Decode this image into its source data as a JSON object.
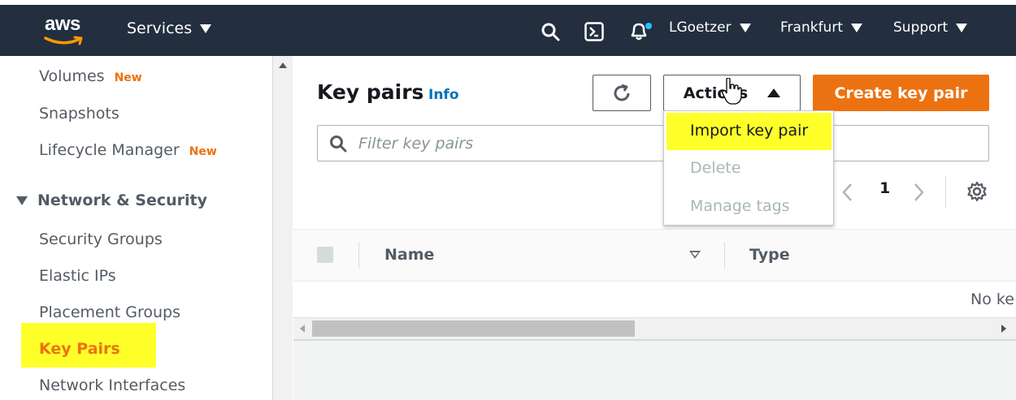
{
  "topbar": {
    "logo_text": "aws",
    "services_label": "Services",
    "user_label": "LGoetzer",
    "region_label": "Frankfurt",
    "support_label": "Support"
  },
  "sidebar": {
    "items": [
      {
        "label": "Volumes",
        "badge": "New"
      },
      {
        "label": "Snapshots"
      },
      {
        "label": "Lifecycle Manager",
        "badge": "New"
      }
    ],
    "section_title": "Network & Security",
    "section_items": [
      {
        "label": "Security Groups"
      },
      {
        "label": "Elastic IPs"
      },
      {
        "label": "Placement Groups"
      },
      {
        "label": "Key Pairs",
        "active": true
      },
      {
        "label": "Network Interfaces"
      }
    ]
  },
  "main": {
    "title": "Key pairs",
    "info_label": "Info",
    "actions_label": "Actions",
    "create_label": "Create key pair",
    "filter_placeholder": "Filter key pairs",
    "pagination": {
      "current_page": "1"
    },
    "columns": [
      "Name",
      "Type"
    ],
    "empty_text": "No ke"
  },
  "actions_menu": {
    "items": [
      {
        "label": "Import key pair",
        "enabled": true,
        "highlighted": true
      },
      {
        "label": "Delete",
        "enabled": false
      },
      {
        "label": "Manage tags",
        "enabled": false
      }
    ]
  },
  "colors": {
    "nav_bg": "#232f3e",
    "accent_orange": "#ec7211",
    "link_blue": "#0073bb",
    "highlight_yellow": "#ffff29"
  }
}
